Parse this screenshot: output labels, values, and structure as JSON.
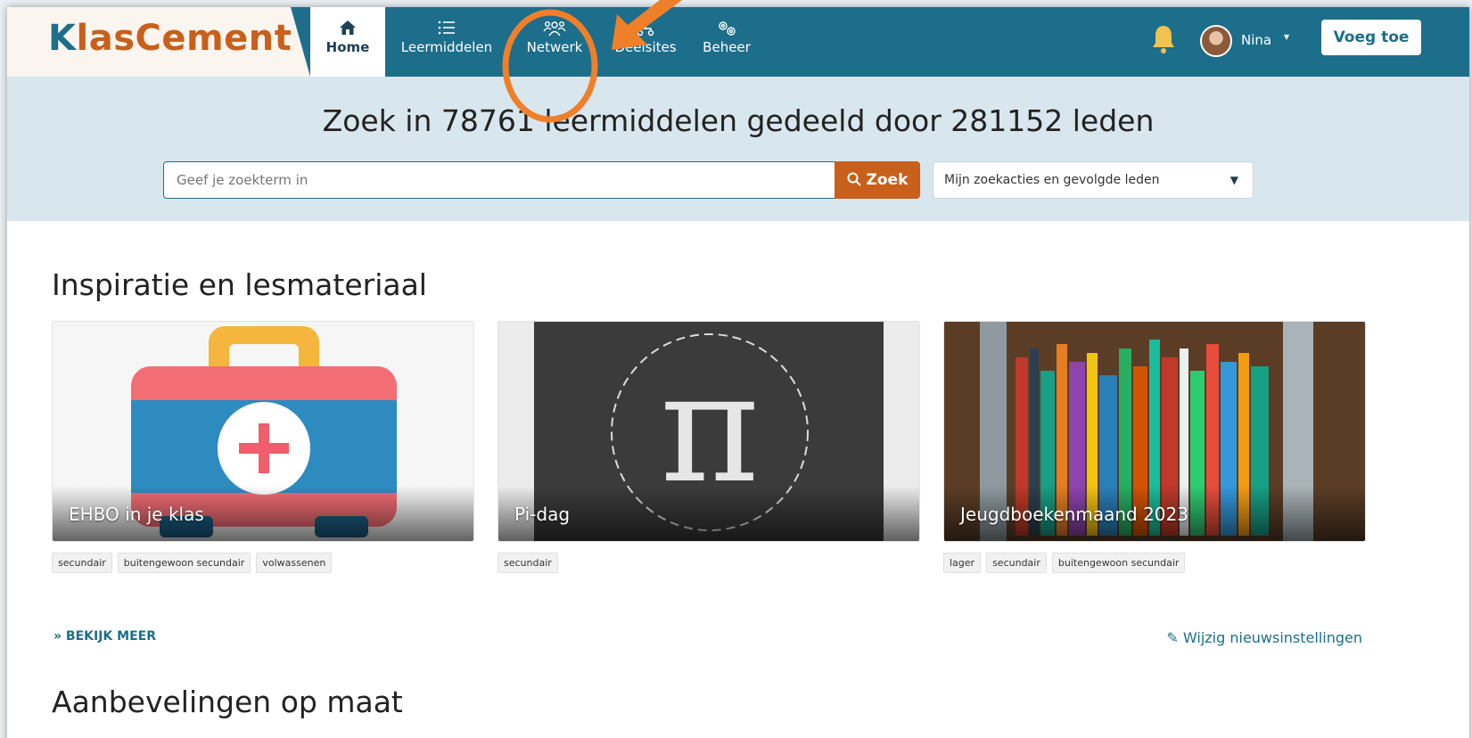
{
  "header": {
    "logo": {
      "k": "K",
      "rest": "lasCement"
    },
    "nav": [
      {
        "label": "Home",
        "icon": "home-icon"
      },
      {
        "label": "Leermiddelen",
        "icon": "list-icon"
      },
      {
        "label": "Netwerk",
        "icon": "users-icon"
      },
      {
        "label": "Deelsites",
        "icon": "sitemap-icon"
      },
      {
        "label": "Beheer",
        "icon": "gears-icon"
      }
    ],
    "user_name": "Nina",
    "add_button": "Voeg toe"
  },
  "search": {
    "title": "Zoek in 78761 leermiddelen gedeeld door 281152 leden",
    "placeholder": "Geef je zoekterm in",
    "button": "Zoek",
    "select_value": "Mijn zoekacties en gevolgde leden"
  },
  "inspiration": {
    "title": "Inspiratie en lesmateriaal",
    "cards": [
      {
        "caption": "EHBO in je klas",
        "tags": [
          "secundair",
          "buitengewoon secundair",
          "volwassenen"
        ]
      },
      {
        "caption": "Pi-dag",
        "tags": [
          "secundair"
        ]
      },
      {
        "caption": "Jeugdboekenmaand 2023",
        "tags": [
          "lager",
          "secundair",
          "buitengewoon secundair"
        ]
      }
    ],
    "more": "BEKIJK MEER",
    "edit_news": "Wijzig nieuwsinstellingen"
  },
  "next_section_title": "Aanbevelingen op maat",
  "colors": {
    "primary": "#1d6e8a",
    "accent": "#c8601b",
    "annotation": "#f07f2a"
  }
}
